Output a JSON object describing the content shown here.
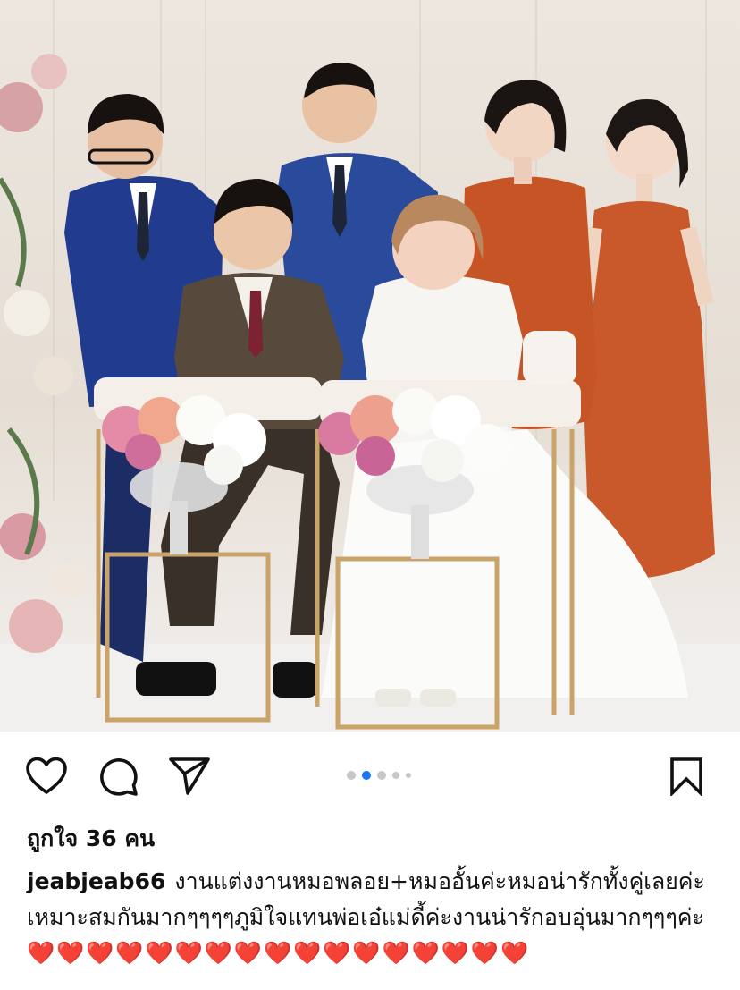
{
  "post": {
    "image_alt": "Wedding ceremony photo: bride and groom seated in front with four guests standing behind",
    "carousel": {
      "total_dots": 5,
      "active_index": 1
    }
  },
  "actions": {
    "like_icon": "heart-outline-icon",
    "comment_icon": "speech-bubble-icon",
    "share_icon": "paper-plane-icon",
    "save_icon": "bookmark-outline-icon"
  },
  "likes": {
    "text": "ถูกใจ 36 คน"
  },
  "caption": {
    "username": "jeabjeab66",
    "text": "งานแต่งงานหมอพลอย+หมออั้นค่ะหมอน่ารักทั้งคู่เลยค่ะเหมาะสมกันมากๆๆๆๆภูมิใจแทนพ่อเอ๋แม่ดี้ค่ะงานน่ารักอบอุ่นมากๆๆๆค่ะ",
    "hearts": "❤️❤️❤️❤️❤️❤️❤️❤️❤️❤️❤️❤️❤️❤️❤️❤️❤️"
  },
  "colors": {
    "accent_blue": "#1877f2",
    "heart_red": "#e0243a"
  }
}
